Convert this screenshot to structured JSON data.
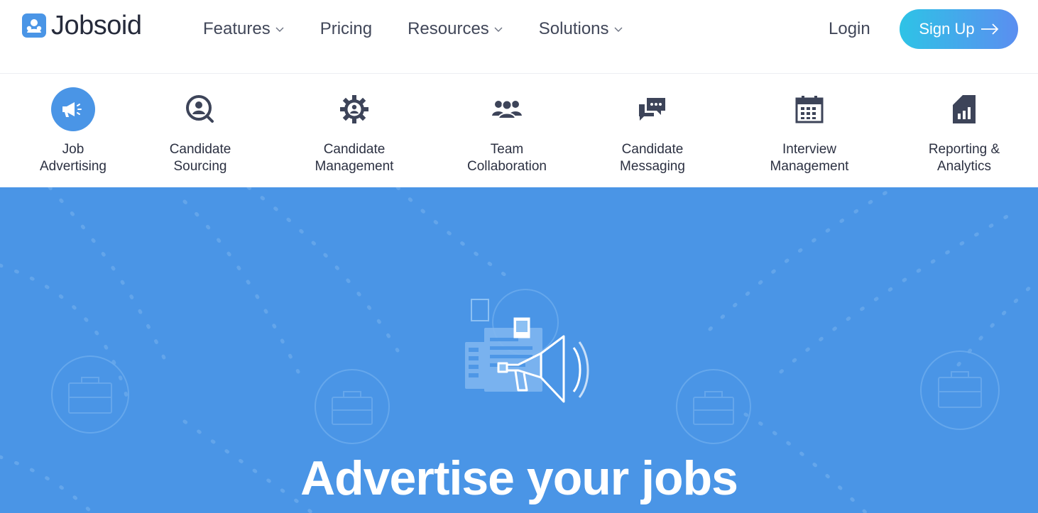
{
  "brand": {
    "name": "Jobsoid",
    "logo_icon": "person-badge-icon",
    "accent": "#4a95e6"
  },
  "nav": {
    "items": [
      {
        "label": "Features",
        "has_dropdown": true
      },
      {
        "label": "Pricing",
        "has_dropdown": false
      },
      {
        "label": "Resources",
        "has_dropdown": true
      },
      {
        "label": "Solutions",
        "has_dropdown": true
      }
    ],
    "login_label": "Login",
    "signup_label": "Sign Up"
  },
  "features": [
    {
      "label": "Job\nAdvertising",
      "icon": "megaphone-icon",
      "active": true
    },
    {
      "label": "Candidate\nSourcing",
      "icon": "search-person-icon",
      "active": false
    },
    {
      "label": "Candidate\nManagement",
      "icon": "gear-person-icon",
      "active": false
    },
    {
      "label": "Team\nCollaboration",
      "icon": "team-icon",
      "active": false
    },
    {
      "label": "Candidate\nMessaging",
      "icon": "chat-bubbles-icon",
      "active": false
    },
    {
      "label": "Interview\nManagement",
      "icon": "calendar-icon",
      "active": false
    },
    {
      "label": "Reporting &\nAnalytics",
      "icon": "bar-chart-icon",
      "active": false
    }
  ],
  "hero": {
    "title": "Advertise your jobs",
    "background": "#4a95e6",
    "illustration": "megaphone-job-board-icon"
  }
}
